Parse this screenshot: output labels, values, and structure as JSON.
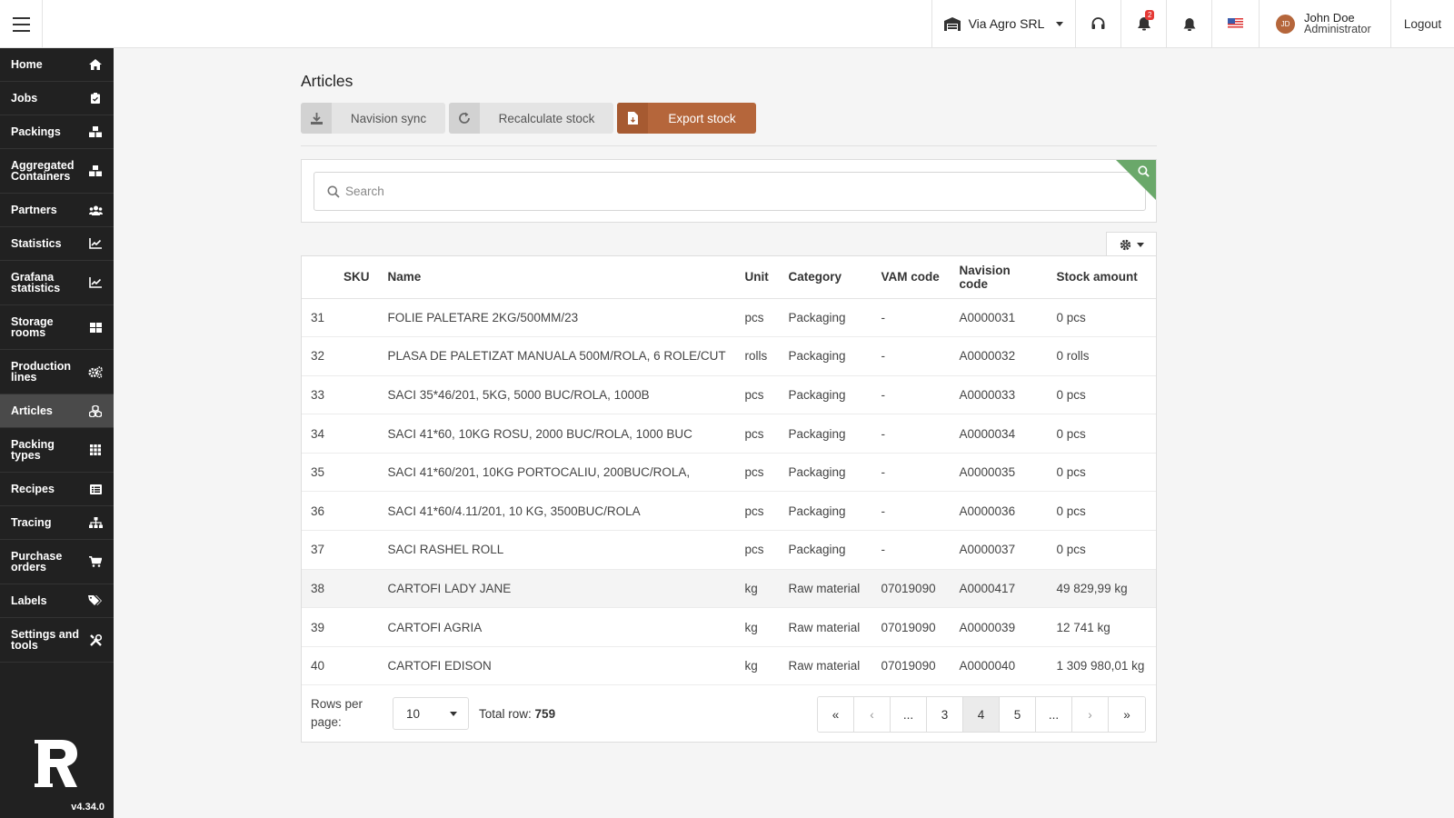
{
  "topbar": {
    "company": "Via Agro SRL",
    "alerts_count": "2",
    "user_initials": "JD",
    "user_name": "John Doe",
    "user_role": "Administrator",
    "logout": "Logout"
  },
  "sidebar": {
    "items": [
      {
        "label": "Home",
        "icon": "home-icon"
      },
      {
        "label": "Jobs",
        "icon": "clipboard-icon"
      },
      {
        "label": "Packings",
        "icon": "boxes-icon"
      },
      {
        "label": "Aggregated Containers",
        "icon": "boxes-icon"
      },
      {
        "label": "Partners",
        "icon": "users-icon"
      },
      {
        "label": "Statistics",
        "icon": "chart-icon"
      },
      {
        "label": "Grafana statistics",
        "icon": "chart-icon"
      },
      {
        "label": "Storage rooms",
        "icon": "grid-icon"
      },
      {
        "label": "Production lines",
        "icon": "cogs-icon"
      },
      {
        "label": "Articles",
        "icon": "cubes-icon"
      },
      {
        "label": "Packing types",
        "icon": "grid-icon"
      },
      {
        "label": "Recipes",
        "icon": "list-icon"
      },
      {
        "label": "Tracing",
        "icon": "sitemap-icon"
      },
      {
        "label": "Purchase orders",
        "icon": "cart-icon"
      },
      {
        "label": "Labels",
        "icon": "tags-icon"
      },
      {
        "label": "Settings and tools",
        "icon": "tools-icon"
      }
    ],
    "version": "v4.34.0",
    "active_color": "#4a4a4a"
  },
  "page": {
    "title": "Articles",
    "actions": {
      "navision_sync": "Navision sync",
      "recalculate_stock": "Recalculate stock",
      "export_stock": "Export stock"
    },
    "search_placeholder": "Search",
    "accent_color": "#b5663b",
    "search_corner_color": "#6aa86a"
  },
  "table": {
    "columns": [
      "",
      "SKU",
      "Name",
      "Unit",
      "Category",
      "VAM code",
      "Navision code",
      "Stock amount"
    ],
    "rows": [
      {
        "id": "31",
        "sku": "",
        "name": "FOLIE PALETARE 2KG/500MM/23",
        "unit": "pcs",
        "category": "Packaging",
        "vam": "-",
        "navision": "A0000031",
        "stock": "0 pcs"
      },
      {
        "id": "32",
        "sku": "",
        "name": "PLASA DE PALETIZAT MANUALA 500M/ROLA, 6 ROLE/CUT",
        "unit": "rolls",
        "category": "Packaging",
        "vam": "-",
        "navision": "A0000032",
        "stock": "0 rolls"
      },
      {
        "id": "33",
        "sku": "",
        "name": "SACI 35*46/201, 5KG, 5000 BUC/ROLA, 1000B",
        "unit": "pcs",
        "category": "Packaging",
        "vam": "-",
        "navision": "A0000033",
        "stock": "0 pcs"
      },
      {
        "id": "34",
        "sku": "",
        "name": "SACI 41*60, 10KG ROSU, 2000 BUC/ROLA, 1000 BUC",
        "unit": "pcs",
        "category": "Packaging",
        "vam": "-",
        "navision": "A0000034",
        "stock": "0 pcs"
      },
      {
        "id": "35",
        "sku": "",
        "name": "SACI 41*60/201, 10KG PORTOCALIU, 200BUC/ROLA,",
        "unit": "pcs",
        "category": "Packaging",
        "vam": "-",
        "navision": "A0000035",
        "stock": "0 pcs"
      },
      {
        "id": "36",
        "sku": "",
        "name": "SACI 41*60/4.11/201, 10 KG, 3500BUC/ROLA",
        "unit": "pcs",
        "category": "Packaging",
        "vam": "-",
        "navision": "A0000036",
        "stock": "0 pcs"
      },
      {
        "id": "37",
        "sku": "",
        "name": "SACI RASHEL ROLL",
        "unit": "pcs",
        "category": "Packaging",
        "vam": "-",
        "navision": "A0000037",
        "stock": "0 pcs"
      },
      {
        "id": "38",
        "sku": "",
        "name": "CARTOFI LADY JANE",
        "unit": "kg",
        "category": "Raw material",
        "vam": "07019090",
        "navision": "A0000417",
        "stock": "49 829,99 kg"
      },
      {
        "id": "39",
        "sku": "",
        "name": "CARTOFI AGRIA",
        "unit": "kg",
        "category": "Raw material",
        "vam": "07019090",
        "navision": "A0000039",
        "stock": "12 741 kg"
      },
      {
        "id": "40",
        "sku": "",
        "name": "CARTOFI EDISON",
        "unit": "kg",
        "category": "Raw material",
        "vam": "07019090",
        "navision": "A0000040",
        "stock": "1 309 980,01 kg"
      }
    ]
  },
  "pagination": {
    "rows_per_page_label": "Rows per page:",
    "rows_per_page_value": "10",
    "total_label": "Total row:",
    "total_value": "759",
    "pages": [
      "«",
      "‹",
      "...",
      "3",
      "4",
      "5",
      "...",
      "›",
      "»"
    ],
    "current_page": "4"
  }
}
